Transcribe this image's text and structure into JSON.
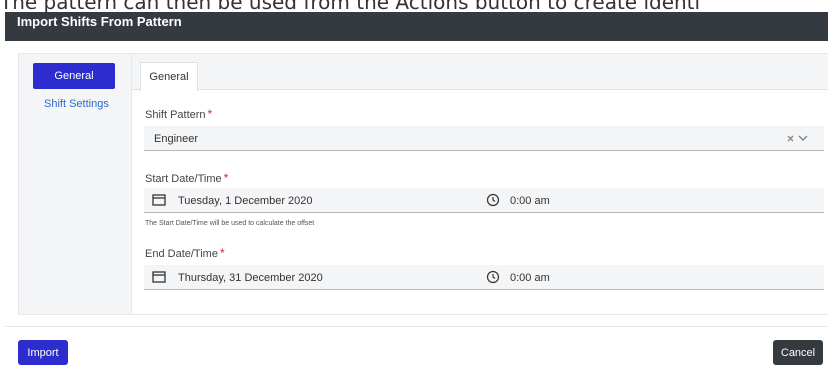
{
  "background_text": "The pattern can then be used from the Actions button to create identi",
  "dialog": {
    "title": "Import Shifts From Pattern"
  },
  "nav": {
    "items": [
      {
        "label": "General",
        "active": true
      },
      {
        "label": "Shift Settings",
        "active": false
      }
    ]
  },
  "tabs": [
    {
      "label": "General"
    }
  ],
  "form": {
    "shift_pattern": {
      "label": "Shift Pattern",
      "required_mark": "*",
      "value": "Engineer"
    },
    "start": {
      "label": "Start Date/Time",
      "required_mark": "*",
      "date": "Tuesday, 1 December 2020",
      "time": "0:00 am",
      "help": "The Start Date/Time will be used to calculate the offset"
    },
    "end": {
      "label": "End Date/Time",
      "required_mark": "*",
      "date": "Thursday, 31 December 2020",
      "time": "0:00 am"
    }
  },
  "buttons": {
    "import": "Import",
    "cancel": "Cancel"
  },
  "colors": {
    "primary": "#2c2ccf",
    "header": "#343a40",
    "required": "#e02424",
    "link": "#2c6acf"
  },
  "icons": [
    "clear-icon",
    "chevron-down-icon",
    "calendar-icon",
    "clock-icon"
  ]
}
